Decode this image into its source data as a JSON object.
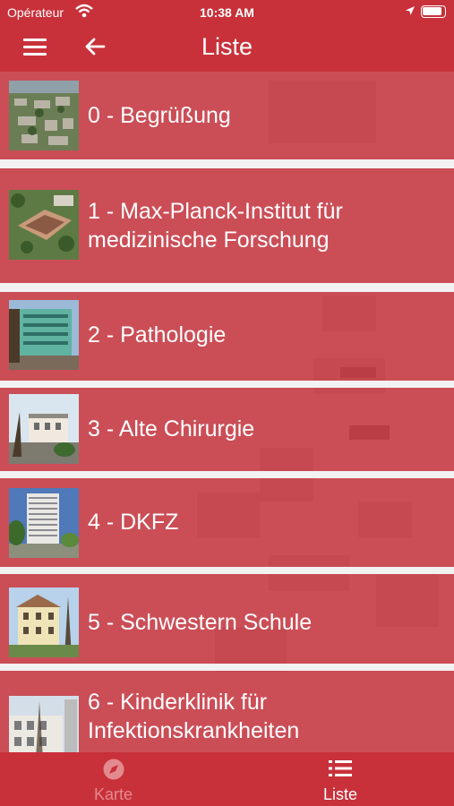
{
  "status": {
    "carrier": "Opérateur",
    "time": "10:38 AM"
  },
  "nav": {
    "title": "Liste",
    "menu_icon": "hamburger-icon",
    "back_icon": "arrow-left-icon"
  },
  "items": [
    {
      "label": "0 - Begrüßung",
      "thumb": "aerial-campus-photo"
    },
    {
      "label": "1 - Max-Planck-Institut für medizinische Forschung",
      "thumb": "aerial-institute-photo"
    },
    {
      "label": "2 - Pathologie",
      "thumb": "green-building-photo"
    },
    {
      "label": "3 - Alte Chirurgie",
      "thumb": "old-surgery-building-photo"
    },
    {
      "label": "4 - DKFZ",
      "thumb": "dkfz-tower-photo"
    },
    {
      "label": "5 - Schwestern Schule",
      "thumb": "nursing-school-photo"
    },
    {
      "label": "6 - Kinderklinik für Infektionskrankheiten",
      "thumb": "childrens-clinic-photo"
    }
  ],
  "tabs": [
    {
      "label": "Karte",
      "icon": "compass-icon",
      "active": false
    },
    {
      "label": "Liste",
      "icon": "list-icon",
      "active": true
    }
  ],
  "colors": {
    "primary": "#c8313a",
    "tab_inactive": "#e38a8f",
    "tab_active": "#ffffff"
  }
}
